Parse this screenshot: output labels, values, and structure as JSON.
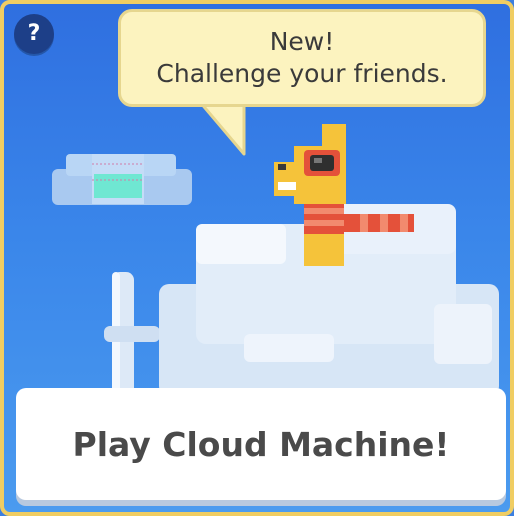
{
  "help": {
    "icon": "question-mark-icon",
    "label": "?"
  },
  "announcement": {
    "line1": "New!",
    "line2": "Challenge your friends."
  },
  "scene": {
    "character": "giraffe-with-goggles-and-scarf",
    "props": [
      "cloud-machine-pipe",
      "small-cloud-machine-box",
      "cloud-platform"
    ]
  },
  "play_button": {
    "label": "Play Cloud Machine!"
  },
  "colors": {
    "border": "#f0cd62",
    "sky": "#3a86ea",
    "bubble": "#fcf3bf",
    "button_text": "#4a4a4a"
  }
}
